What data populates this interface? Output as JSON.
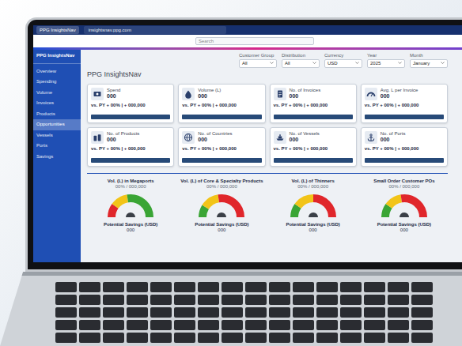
{
  "browser": {
    "tab": "PPG InsightsNav",
    "url": "insightsnav.ppg.com"
  },
  "header": {
    "search": {
      "placeholder": "Search"
    }
  },
  "sidebar": {
    "title": "PPG InsightsNav",
    "items": [
      {
        "label": "Overview",
        "selected": false
      },
      {
        "label": "Spending",
        "selected": false
      },
      {
        "label": "Volume",
        "selected": false
      },
      {
        "label": "Invoices",
        "selected": false
      },
      {
        "label": "Products",
        "selected": false
      },
      {
        "label": "Opportunities",
        "selected": true
      },
      {
        "label": "Vessels",
        "selected": false
      },
      {
        "label": "Ports",
        "selected": false
      },
      {
        "label": "Savings",
        "selected": false
      }
    ]
  },
  "filters": [
    {
      "label": "Customer Group",
      "value": "All"
    },
    {
      "label": "Distribution",
      "value": "All"
    },
    {
      "label": "Currency",
      "value": "USD"
    },
    {
      "label": "Year",
      "value": "2025"
    },
    {
      "label": "Month",
      "value": "January"
    }
  ],
  "page": {
    "title": "PPG InsightsNav"
  },
  "cards": [
    {
      "kind": "money",
      "label": "Spend",
      "value": "000",
      "comparison": "vs. PY + 00% | + 000,000"
    },
    {
      "kind": "drop",
      "label": "Volume (L)",
      "value": "000",
      "comparison": "vs. PY + 00% | + 000,000"
    },
    {
      "kind": "document",
      "label": "No. of Invoices",
      "value": "000",
      "comparison": "vs. PY + 00% | + 000,000"
    },
    {
      "kind": "gauge",
      "label": "Avg. L per Invoice",
      "value": "000",
      "comparison": "vs. PY + 00% | + 000,000"
    },
    {
      "kind": "barrel",
      "label": "No. of Products",
      "value": "000",
      "comparison": "vs. PY + 00% | + 000,000"
    },
    {
      "kind": "globe",
      "label": "No. of Countries",
      "value": "000",
      "comparison": "vs. PY + 00% | + 000,000"
    },
    {
      "kind": "ship",
      "label": "No. of Vessels",
      "value": "000",
      "comparison": "vs. PY + 00% | + 000,000"
    },
    {
      "kind": "anchor",
      "label": "No. of Ports",
      "value": "000",
      "comparison": "vs. PY + 00% | + 000,000"
    }
  ],
  "gauges": [
    {
      "title": "Vol. (L) in Megaports",
      "subtitle": "00% / 000,000",
      "caption": "Potential Savings (USD)",
      "value": "000",
      "segments": [
        {
          "share": 0.2,
          "color": "#e0262b"
        },
        {
          "share": 0.25,
          "color": "#f2c418"
        },
        {
          "share": 0.55,
          "color": "#3aa535"
        }
      ]
    },
    {
      "title": "Vol. (L) of Core & Specialty Products",
      "subtitle": "00% / 000,000",
      "caption": "Potential Savings (USD)",
      "value": "000",
      "segments": [
        {
          "share": 0.18,
          "color": "#3aa535"
        },
        {
          "share": 0.27,
          "color": "#f2c418"
        },
        {
          "share": 0.55,
          "color": "#e0262b"
        }
      ]
    },
    {
      "title": "Vol. (L) of Thinners",
      "subtitle": "00% / 000,000",
      "caption": "Potential Savings (USD)",
      "value": "000",
      "segments": [
        {
          "share": 0.2,
          "color": "#3aa535"
        },
        {
          "share": 0.3,
          "color": "#f2c418"
        },
        {
          "share": 0.5,
          "color": "#e0262b"
        }
      ]
    },
    {
      "title": "Small Order Customer POs",
      "subtitle": "00% / 000,000",
      "caption": "Potential Savings (USD)",
      "value": "000",
      "segments": [
        {
          "share": 0.2,
          "color": "#3aa535"
        },
        {
          "share": 0.25,
          "color": "#f2c418"
        },
        {
          "share": 0.55,
          "color": "#e0262b"
        }
      ]
    }
  ]
}
